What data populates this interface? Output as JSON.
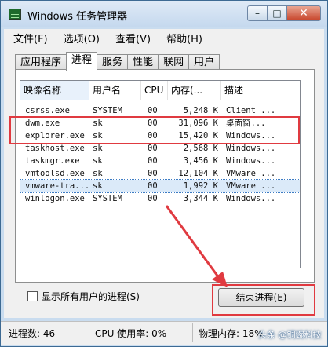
{
  "window": {
    "title": "Windows 任务管理器"
  },
  "menu": [
    "文件(F)",
    "选项(O)",
    "查看(V)",
    "帮助(H)"
  ],
  "tabs": [
    {
      "label": "应用程序",
      "active": false
    },
    {
      "label": "进程",
      "active": true
    },
    {
      "label": "服务",
      "active": false
    },
    {
      "label": "性能",
      "active": false
    },
    {
      "label": "联网",
      "active": false
    },
    {
      "label": "用户",
      "active": false
    }
  ],
  "columns": [
    "映像名称",
    "用户名",
    "CPU",
    "内存(...",
    "描述"
  ],
  "processes": [
    {
      "name": "csrss.exe",
      "user": "SYSTEM",
      "cpu": "00",
      "mem": "5,248 K",
      "desc": "Client ..."
    },
    {
      "name": "dwm.exe",
      "user": "sk",
      "cpu": "00",
      "mem": "31,096 K",
      "desc": "桌面窗..."
    },
    {
      "name": "explorer.exe",
      "user": "sk",
      "cpu": "00",
      "mem": "15,420 K",
      "desc": "Windows..."
    },
    {
      "name": "taskhost.exe",
      "user": "sk",
      "cpu": "00",
      "mem": "2,568 K",
      "desc": "Windows..."
    },
    {
      "name": "taskmgr.exe",
      "user": "sk",
      "cpu": "00",
      "mem": "3,456 K",
      "desc": "Windows..."
    },
    {
      "name": "vmtoolsd.exe",
      "user": "sk",
      "cpu": "00",
      "mem": "12,104 K",
      "desc": "VMware ..."
    },
    {
      "name": "vmware-tra...",
      "user": "sk",
      "cpu": "00",
      "mem": "1,992 K",
      "desc": "VMware ..."
    },
    {
      "name": "winlogon.exe",
      "user": "SYSTEM",
      "cpu": "00",
      "mem": "3,344 K",
      "desc": "Windows..."
    }
  ],
  "selected_index": 6,
  "show_all_label": "显示所有用户的进程(S)",
  "end_process_label": "结束进程(E)",
  "status": {
    "processes": "进程数: 46",
    "cpu": "CPU 使用率: 0%",
    "memory": "物理内存: 18%"
  },
  "watermark": "头条 @铜豌科技",
  "colors": {
    "highlight": "#e03a40",
    "selection": "#dbeaf9"
  }
}
